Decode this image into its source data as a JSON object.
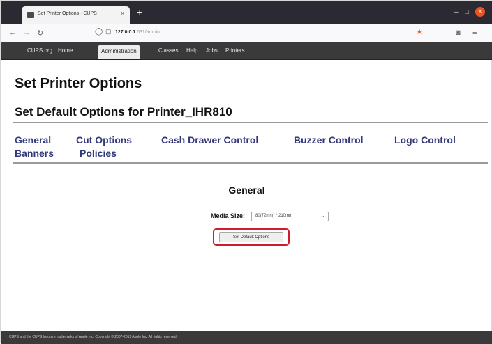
{
  "browser": {
    "tab_title": "Set Printer Options - CUPS",
    "tab_close": "×",
    "new_tab": "+",
    "url_host": "127.0.0.1",
    "url_rest": ":631/admin",
    "minimize": "–",
    "maximize": "□",
    "close": "×"
  },
  "cups_nav": {
    "items": [
      "CUPS.org",
      "Home",
      "Administration",
      "Classes",
      "Help",
      "Jobs",
      "Printers"
    ],
    "active": "Administration"
  },
  "page": {
    "title": "Set Printer Options",
    "subtitle": "Set Default Options for Printer_IHR810",
    "option_links": [
      "General",
      "Cut Options",
      "Cash Drawer Control",
      "Buzzer Control",
      "Logo Control",
      "Banners",
      "Policies"
    ],
    "section_title": "General",
    "media_size_label": "Media Size:",
    "media_size_value": "80(72mm) * 210mm",
    "set_default_button": "Set Default Options"
  },
  "footer": {
    "text": "CUPS and the CUPS logo are trademarks of Apple Inc. Copyright © 2007-2019 Apple Inc. All rights reserved."
  },
  "colors": {
    "link": "#32387a",
    "highlight": "#d11a2a",
    "menubar": "#3a3a3a",
    "bookmark_star": "#e2632a"
  }
}
